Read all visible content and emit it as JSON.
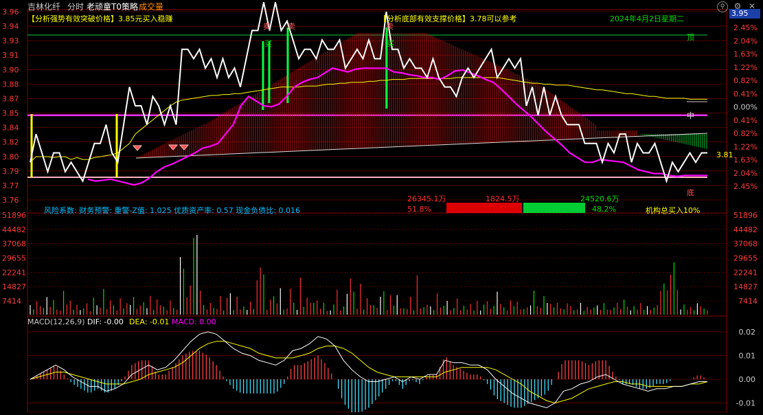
{
  "header": {
    "stock_name": "吉林化纤",
    "mode": "分时",
    "strategy": "老顽童T0策略",
    "volume_tab": "成交量",
    "breakout_text": "【分析强势有效突破价格】3.85元买入稳赚",
    "support_text": "【分析底部有效支撑价格】3.78可以参考",
    "date_text": "2024年4月2日星期二",
    "current_price": "3.95"
  },
  "labels": {
    "top": "顶",
    "mid": "中",
    "bottom": "底",
    "price_tag": "3.81",
    "sell1": "卖",
    "sell2": "卖",
    "sell3": "卖",
    "buy_marker": "买",
    "buy_marker2": "买"
  },
  "info_bar": {
    "factor_text": "风险系数: 财务预警: 重警-Z值: 1.025 优质资产率: 0.57 现金负债比: 0.016",
    "buy_amount": "26345.1万",
    "mid_amount": "1824.5万",
    "sell_amount": "24520.6万",
    "buy_pct": "51.8%",
    "sell_pct": "48.2%",
    "inst_text": "机构总买入10%"
  },
  "macd_header": {
    "name": "MACD(12,26,9)",
    "dif": "DIF: -0.00",
    "dea": "DEA: -0.01",
    "macd": "MACD: 0.00"
  },
  "colors": {
    "price_line": "#ffffff",
    "avg_line": "#ffff00",
    "magenta_line": "#ff00ff",
    "up_bar": "#ff3030",
    "down_bar": "#00e000",
    "grid": "#8b0000",
    "axis_label": "#ff3b3b"
  },
  "chart_data": [
    {
      "type": "line",
      "title": "",
      "ylim": [
        3.76,
        3.96
      ],
      "yticks": [
        "3.96",
        "3.94",
        "3.93",
        "3.91",
        "3.90",
        "3.88",
        "3.87",
        "3.85",
        "3.84",
        "3.82",
        "3.80",
        "3.79",
        "3.77",
        "3.76"
      ],
      "pct_ticks": [
        "2.45%",
        "2.04%",
        "1.63%",
        "1.22%",
        "0.82%",
        "0.41%",
        "0.00%",
        "0.41%",
        "0.82%",
        "1.22%",
        "1.63%",
        "2.04%",
        "2.45%"
      ],
      "prev_close": 3.85,
      "series": [
        {
          "values": [
            3.8,
            3.83,
            3.81,
            3.79,
            3.81,
            3.81,
            3.79,
            3.8,
            3.79,
            3.78,
            3.8,
            3.82,
            3.82,
            3.84,
            3.81,
            3.8,
            3.84,
            3.88,
            3.86,
            3.86,
            3.84,
            3.87,
            3.86,
            3.84,
            3.86,
            3.84,
            3.92,
            3.92,
            3.91,
            3.92,
            3.9,
            3.91,
            3.89,
            3.91,
            3.89,
            3.9,
            3.88,
            3.91,
            3.94,
            3.94,
            3.97,
            3.94,
            3.97,
            3.94,
            3.95,
            3.93,
            3.91,
            3.92,
            3.92,
            3.91,
            3.93,
            3.92,
            3.92,
            3.93,
            3.9,
            3.91,
            3.92,
            3.91,
            3.93,
            3.91,
            3.91,
            3.96,
            3.92,
            3.92,
            3.9,
            3.91,
            3.9,
            3.9,
            3.89,
            3.91,
            3.89,
            3.88,
            3.88,
            3.87,
            3.89,
            3.9,
            3.89,
            3.9,
            3.91,
            3.92,
            3.89,
            3.9,
            3.91,
            3.9,
            3.91,
            3.86,
            3.88,
            3.85,
            3.88,
            3.85,
            3.87,
            3.85,
            3.84,
            3.84,
            3.84,
            3.82,
            3.82,
            3.82,
            3.8,
            3.82,
            3.81,
            3.83,
            3.83,
            3.8,
            3.82,
            3.81,
            3.81,
            3.82,
            3.8,
            3.78,
            3.8,
            3.79,
            3.8,
            3.81,
            3.8,
            3.81,
            3.81
          ]
        },
        {
          "values": [
            3.8,
            3.806,
            3.806,
            3.806,
            3.805,
            3.806,
            3.806,
            3.803,
            3.805,
            3.803,
            3.803,
            3.805,
            3.806,
            3.807,
            3.808,
            3.81,
            3.815,
            3.82,
            3.83,
            3.835,
            3.84,
            3.845,
            3.85,
            3.855,
            3.86,
            3.864,
            3.866,
            3.867,
            3.868,
            3.869,
            3.87,
            3.871,
            3.871,
            3.872,
            3.872,
            3.873,
            3.873,
            3.874,
            3.875,
            3.876,
            3.877,
            3.878,
            3.879,
            3.88,
            3.88,
            3.88,
            3.88,
            3.881,
            3.881,
            3.881,
            3.882,
            3.883,
            3.883,
            3.884,
            3.884,
            3.885,
            3.885,
            3.885,
            3.886,
            3.886,
            3.887,
            3.887,
            3.888,
            3.888,
            3.888,
            3.889,
            3.889,
            3.889,
            3.889,
            3.889,
            3.889,
            3.889,
            3.889,
            3.89,
            3.89,
            3.89,
            3.89,
            3.89,
            3.89,
            3.89,
            3.89,
            3.889,
            3.888,
            3.887,
            3.886,
            3.885,
            3.884,
            3.884,
            3.883,
            3.883,
            3.882,
            3.882,
            3.882,
            3.881,
            3.88,
            3.879,
            3.878,
            3.877,
            3.877,
            3.876,
            3.875,
            3.874,
            3.873,
            3.873,
            3.872,
            3.871,
            3.87,
            3.87,
            3.869,
            3.868,
            3.868,
            3.868,
            3.868,
            3.867,
            3.867,
            3.867,
            3.867
          ]
        },
        {
          "values": [
            3.782,
            3.78,
            3.781,
            3.782,
            3.78,
            3.778,
            3.776,
            3.778,
            3.783,
            3.79,
            3.795,
            3.798,
            3.802,
            3.806,
            3.81,
            3.815,
            3.817,
            3.82,
            3.83,
            3.84,
            3.86,
            3.87,
            3.865,
            3.86,
            3.859,
            3.862,
            3.87,
            3.88,
            3.885,
            3.888,
            3.89,
            3.895,
            3.9,
            3.898,
            3.896,
            3.899,
            3.9,
            3.9,
            3.9,
            3.9,
            3.896,
            3.895,
            3.893,
            3.892,
            3.89,
            3.89,
            3.888,
            3.892,
            3.897,
            3.898,
            3.895,
            3.892,
            3.888,
            3.885,
            3.878,
            3.87,
            3.862,
            3.855,
            3.848,
            3.84,
            3.832,
            3.825,
            3.818,
            3.81,
            3.805,
            3.8,
            3.8,
            3.803,
            3.802,
            3.801,
            3.8,
            3.796,
            3.792,
            3.79,
            3.788,
            3.788,
            3.786,
            3.785,
            3.786,
            3.786,
            3.786,
            3.786
          ]
        }
      ]
    },
    {
      "type": "bar",
      "title": "",
      "ylim": [
        0,
        51896
      ],
      "yticks": [
        "51896",
        "44482",
        "37068",
        "29655",
        "22241",
        "14827",
        "7414"
      ],
      "values": [
        5000,
        2800,
        7000,
        4500,
        3500,
        9200,
        4100,
        7600,
        2600,
        2100,
        12400,
        5300,
        7300,
        2600,
        5100,
        2400,
        3300,
        5900,
        1800,
        8800,
        4900,
        3600,
        13400,
        2900,
        7400,
        4800,
        2300,
        8500,
        3300,
        6000,
        5100,
        9200,
        3000,
        4800,
        6500,
        3400,
        9800,
        2500,
        8000,
        4900,
        4200,
        2400,
        7300,
        3500,
        2600,
        30000,
        24000,
        9000,
        15200,
        39900,
        41500,
        12500,
        5100,
        2700,
        6100,
        3500,
        3000,
        9700,
        2300,
        8800,
        11200,
        2400,
        9400,
        2600,
        4300,
        2500,
        6800,
        3000,
        18000,
        24600,
        21000,
        2600,
        7800,
        9600,
        5900,
        13800,
        2700,
        3200,
        13600,
        6300,
        2500,
        19300,
        4100,
        8800,
        6200,
        6200,
        7400,
        3100,
        6200,
        2000,
        2200,
        5300,
        13000,
        2200,
        4300,
        10900,
        18800,
        12000,
        3200,
        16100,
        2700,
        8600,
        5100,
        4900,
        3600,
        9400,
        12200,
        2500,
        10100,
        4700,
        10200,
        3300,
        3300,
        3000,
        9300,
        2300,
        20500,
        3200,
        3900,
        5200,
        4300,
        2500,
        11200,
        3700,
        4700,
        7200,
        2300,
        3500,
        8500,
        2300,
        4600,
        2700,
        5600,
        2200,
        7200,
        2200,
        5300,
        7000,
        3100,
        4600,
        12000,
        5600,
        3800,
        2200,
        7400,
        4400,
        6800,
        2700,
        2900,
        3900,
        4800,
        12600,
        4400,
        3600,
        9700,
        6100,
        5700,
        3800,
        6100,
        3300,
        2900,
        5900,
        4500,
        2300,
        2800,
        6200,
        2000,
        4100,
        2700,
        3800,
        4800,
        2500,
        6000,
        2600,
        2500,
        3800,
        6200,
        3000,
        7800,
        4200,
        2300,
        4500,
        2700,
        6000,
        2500,
        4500,
        2500,
        3700,
        5100,
        12300,
        16200,
        12700,
        20700,
        27300,
        12800,
        2700,
        5300,
        2600,
        4100,
        2400,
        5900,
        4400,
        3200,
        2300
      ]
    },
    {
      "type": "line",
      "title": "",
      "ylim": [
        -0.011,
        0.022
      ],
      "yticks": [
        "0.02",
        "0.01",
        "0.00",
        "-0.01"
      ],
      "series": [
        {
          "values": [
            0.0,
            0.002,
            0.004,
            0.006,
            0.004,
            0.001,
            -0.001,
            -0.003,
            -0.003,
            -0.005,
            -0.004,
            -0.002,
            0.002,
            0.004,
            0.006,
            0.004,
            0.005,
            0.008,
            0.012,
            0.016,
            0.019,
            0.02,
            0.019,
            0.016,
            0.013,
            0.011,
            0.01,
            0.008,
            0.007,
            0.006,
            0.008,
            0.012,
            0.013,
            0.015,
            0.018,
            0.017,
            0.014,
            0.008,
            0.004,
            0.001,
            -0.001,
            -0.001,
            0.0,
            0.001,
            -0.001,
            0.001,
            0.0,
            0.002,
            0.002,
            0.008,
            0.007,
            0.007,
            0.006,
            0.006,
            0.004,
            0.0,
            -0.003,
            -0.006,
            -0.008,
            -0.01,
            -0.011,
            -0.012,
            -0.01,
            -0.005,
            -0.004,
            -0.002,
            -0.001,
            0.001,
            0.002,
            0.0,
            -0.002,
            -0.003,
            -0.004,
            -0.005,
            -0.004,
            -0.004,
            -0.003,
            -0.003,
            -0.002,
            -0.001,
            -0.001
          ]
        },
        {
          "values": [
            0.0,
            0.001,
            0.002,
            0.003,
            0.003,
            0.002,
            0.001,
            0.0,
            -0.001,
            -0.002,
            -0.002,
            -0.002,
            -0.001,
            0.0,
            0.002,
            0.003,
            0.004,
            0.005,
            0.007,
            0.01,
            0.013,
            0.015,
            0.016,
            0.016,
            0.015,
            0.014,
            0.013,
            0.011,
            0.01,
            0.009,
            0.009,
            0.009,
            0.01,
            0.011,
            0.013,
            0.014,
            0.014,
            0.013,
            0.011,
            0.008,
            0.005,
            0.003,
            0.002,
            0.001,
            0.001,
            0.001,
            0.001,
            0.001,
            0.001,
            0.003,
            0.004,
            0.005,
            0.005,
            0.005,
            0.005,
            0.004,
            0.002,
            0.0,
            -0.002,
            -0.005,
            -0.007,
            -0.009,
            -0.01,
            -0.009,
            -0.008,
            -0.006,
            -0.004,
            -0.003,
            -0.002,
            -0.001,
            -0.001,
            -0.002,
            -0.002,
            -0.003,
            -0.003,
            -0.003,
            -0.003,
            -0.003,
            -0.002,
            -0.002,
            -0.001
          ]
        }
      ]
    }
  ]
}
